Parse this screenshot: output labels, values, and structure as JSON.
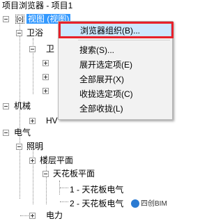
{
  "window": {
    "title": "项目浏览器 - 项目1"
  },
  "tree": {
    "root_label": "视图 (视图)",
    "items": [
      {
        "label": "卫浴"
      },
      {
        "label": "卫"
      },
      {
        "label": "机械"
      },
      {
        "label": "HV"
      },
      {
        "label": "电气"
      },
      {
        "label": "照明"
      },
      {
        "label": "楼层平面"
      },
      {
        "label": "天花板平面"
      },
      {
        "label": "1 - 天花板电气"
      },
      {
        "label": "2 - 天花板电气"
      },
      {
        "label": "电力"
      }
    ]
  },
  "context_menu": {
    "items": [
      {
        "label": "浏览器组织(B)..."
      },
      {
        "label": "搜索(S)..."
      },
      {
        "label": "展开选定项(E)"
      },
      {
        "label": "全部展开(X)"
      },
      {
        "label": "收拢选定项(C)"
      },
      {
        "label": "全部收拢(L)"
      }
    ]
  },
  "watermark": {
    "text": "四创BIM"
  },
  "colors": {
    "selection": "#3399ff",
    "menu_highlight": "#cde8ff",
    "annotation_frame": "#e8212a"
  }
}
